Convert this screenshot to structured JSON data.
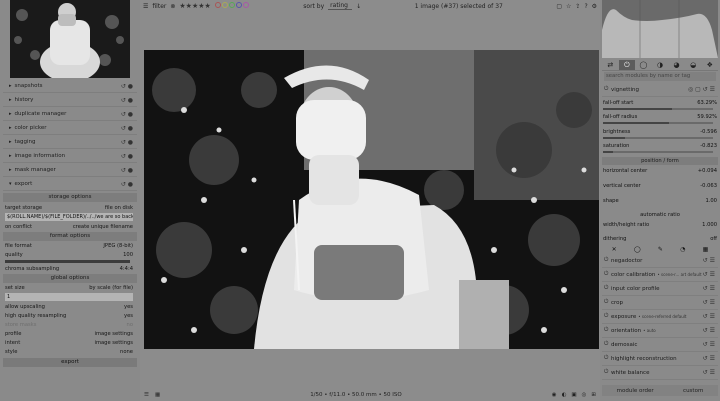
{
  "topbar": {
    "filter_label": "filter",
    "stars": "★★★★★",
    "sort_label": "sort by",
    "sort_value": "rating",
    "image_count": "1 image (#37) selected of 37"
  },
  "left": {
    "modules": [
      {
        "label": "snapshots"
      },
      {
        "label": "history"
      },
      {
        "label": "duplicate manager"
      },
      {
        "label": "color picker"
      },
      {
        "label": "tagging"
      },
      {
        "label": "image information"
      },
      {
        "label": "mask manager"
      },
      {
        "label": "export"
      }
    ],
    "storage_options": "storage options",
    "target_storage": {
      "label": "target storage",
      "value": "file on disk"
    },
    "path": "$(ROLL.NAME)/$(FILE_FOLDER)/../../we are so back/processed/$(FILE_NAME)",
    "on_conflict": {
      "label": "on conflict",
      "value": "create unique filename"
    },
    "format_options": "format options",
    "file_format": {
      "label": "file format",
      "value": "JPEG (8-bit)"
    },
    "quality": {
      "label": "quality",
      "value": "100",
      "fraction": 1.0
    },
    "chroma": {
      "label": "chroma subsampling",
      "value": "4:4:4"
    },
    "global_options": "global options",
    "set_size": {
      "label": "set size",
      "value": "by scale (for file)"
    },
    "scale_value": "1",
    "allow_upscaling": {
      "label": "allow upscaling",
      "value": "yes"
    },
    "high_quality": {
      "label": "high quality resampling",
      "value": "yes"
    },
    "store_masks": {
      "label": "store masks",
      "value": "no"
    },
    "profile": {
      "label": "profile",
      "value": "image settings"
    },
    "intent": {
      "label": "intent",
      "value": "image settings"
    },
    "style": {
      "label": "style",
      "value": "none"
    },
    "export_button": "export"
  },
  "bottombar": {
    "exif": "1/50 • f/11.0 • 50.0 mm • 50 ISO"
  },
  "right": {
    "search_placeholder": "search modules by name or tag",
    "vignetting": "vignetting",
    "falloff_start": {
      "label": "fall-off start",
      "value": "63.29%",
      "fraction": 0.63
    },
    "falloff_radius": {
      "label": "fall-off radius",
      "value": "59.92%",
      "fraction": 0.6
    },
    "brightness": {
      "label": "brightness",
      "value": "-0.596",
      "fraction": 0.2
    },
    "saturation": {
      "label": "saturation",
      "value": "-0.823",
      "fraction": 0.09
    },
    "position_form": "position / form",
    "horizontal_center": {
      "label": "horizontal center",
      "value": "+0.094"
    },
    "vertical_center": {
      "label": "vertical center",
      "value": "-0.063"
    },
    "shape": {
      "label": "shape",
      "value": "1.00"
    },
    "automatic_ratio": "automatic ratio",
    "width_height": {
      "label": "width/height ratio",
      "value": "1.000"
    },
    "dithering": {
      "label": "dithering",
      "value": "off"
    },
    "modules": [
      {
        "label": "negadoctor",
        "sub": ""
      },
      {
        "label": "color calibration",
        "sub": "• scene-r... art default"
      },
      {
        "label": "input color profile",
        "sub": ""
      },
      {
        "label": "crop",
        "sub": ""
      },
      {
        "label": "exposure",
        "sub": "• scene-referred default"
      },
      {
        "label": "orientation",
        "sub": "• auto"
      },
      {
        "label": "demosaic",
        "sub": ""
      },
      {
        "label": "highlight reconstruction",
        "sub": ""
      },
      {
        "label": "white balance",
        "sub": ""
      }
    ],
    "module_order": "module order",
    "module_order_value": "custom"
  }
}
